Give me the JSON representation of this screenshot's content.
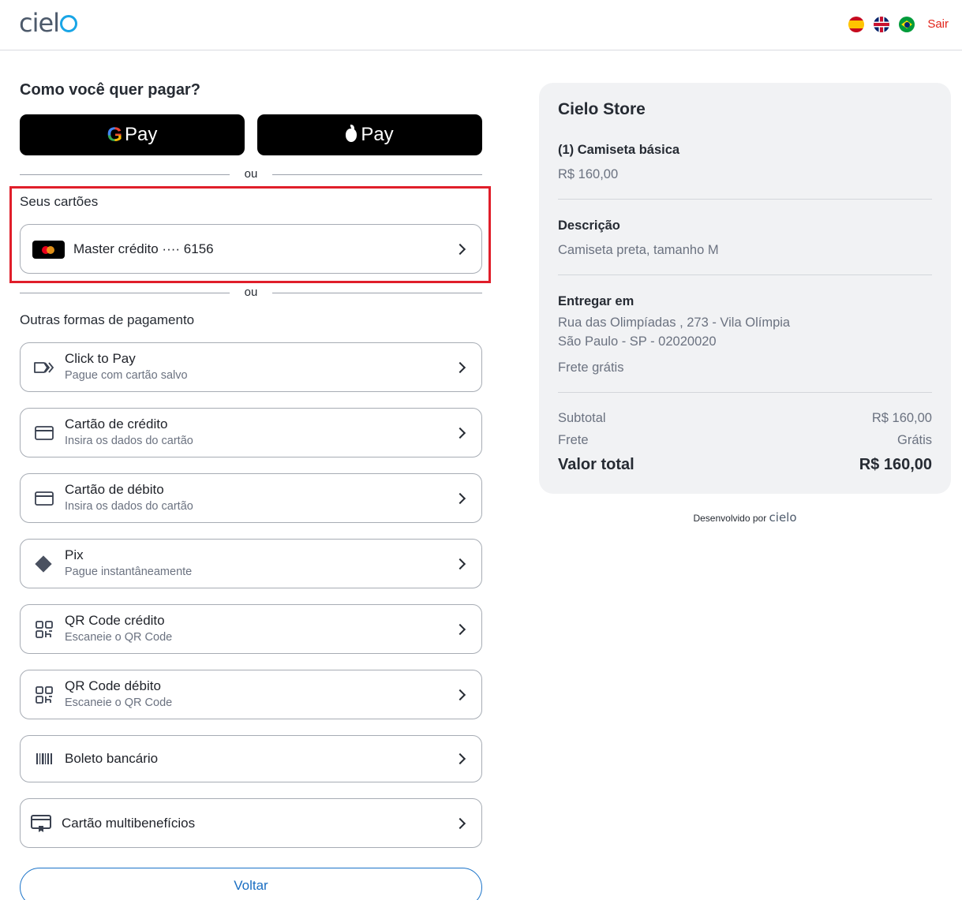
{
  "header": {
    "logo_text": "cielo",
    "flags": [
      "flag-spain-icon",
      "flag-uk-icon",
      "flag-brazil-icon"
    ],
    "logout_label": "Sair"
  },
  "payment": {
    "title": "Como você quer pagar?",
    "gpay_label": "Pay",
    "gpay_g": "G",
    "apay_label": "Pay",
    "divider_text": "ou",
    "saved_cards_label": "Seus cartões",
    "saved_card": "Master crédito ···· 6156",
    "other_label": "Outras formas de pagamento",
    "methods": [
      {
        "title": "Click to Pay",
        "subtitle": "Pague com cartão salvo",
        "icon": "click-to-pay-icon"
      },
      {
        "title": "Cartão de crédito",
        "subtitle": "Insira os dados do cartão",
        "icon": "credit-card-icon"
      },
      {
        "title": "Cartão de débito",
        "subtitle": "Insira os dados do cartão",
        "icon": "debit-card-icon"
      },
      {
        "title": "Pix",
        "subtitle": "Pague instantâneamente",
        "icon": "pix-icon"
      },
      {
        "title": "QR Code crédito",
        "subtitle": "Escaneie o QR Code",
        "icon": "qr-code-icon"
      },
      {
        "title": "QR Code débito",
        "subtitle": "Escaneie o QR Code",
        "icon": "qr-code-icon"
      },
      {
        "title": "Boleto bancário",
        "subtitle": "",
        "icon": "barcode-icon"
      },
      {
        "title": "Cartão multibenefícios",
        "subtitle": "",
        "icon": "benefit-card-icon"
      }
    ],
    "back_label": "Voltar"
  },
  "summary": {
    "store": "Cielo Store",
    "item": "(1) Camiseta básica",
    "item_price": "R$ 160,00",
    "description_label": "Descrição",
    "description": "Camiseta preta, tamanho M",
    "delivery_label": "Entregar em",
    "address_line1": "Rua das Olimpíadas , 273 - Vila Olímpia",
    "address_line2": "São Paulo - SP - 02020020",
    "shipping_note": "Frete grátis",
    "subtotal_label": "Subtotal",
    "subtotal_value": "R$ 160,00",
    "frete_label": "Frete",
    "frete_value": "Grátis",
    "total_label": "Valor total",
    "total_value": "R$ 160,00"
  },
  "footer": {
    "powered_by": "Desenvolvido por",
    "brand": "cielo"
  },
  "colors": {
    "highlight": "#e01e2a",
    "accent_blue": "#1a6ec2",
    "logo_blue": "#19a5e6"
  }
}
